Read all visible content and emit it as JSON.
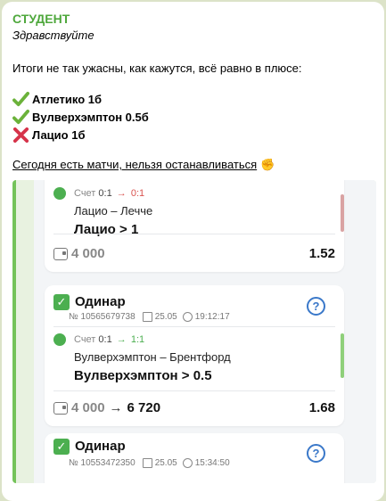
{
  "message": {
    "sender": "СТУДЕНТ",
    "greeting": "Здравствуйте",
    "intro": "Итоги не так ужасны, как кажутся, всё равно в плюсе:",
    "results": [
      {
        "icon": "check-mark-icon",
        "text": "Атлетико 1б"
      },
      {
        "icon": "check-mark-icon",
        "text": "Вулверхэмптон 0.5б"
      },
      {
        "icon": "cross-mark-icon",
        "text": "Лацио 1б"
      }
    ],
    "link_text": "Сегодня есть матчи, нельзя останавливаться",
    "link_emoji": "✊"
  },
  "embed": {
    "card1": {
      "score_label": "Счет",
      "score_from": "0:1",
      "score_to": "0:1",
      "teams": "Лацио – Лечче",
      "pick": "Лацио > 1",
      "stake": "4 000",
      "odds": "1.52",
      "status_color": "#d9a3a3"
    },
    "card2": {
      "title": "Одинар",
      "number": "№ 10565679738",
      "date": "25.05",
      "time": "19:12:17",
      "help": "?",
      "score_label": "Счет",
      "score_from": "0:1",
      "score_to": "1:1",
      "teams": "Вулверхэмптон – Брентфорд",
      "pick": "Вулверхэмптон > 0.5",
      "stake": "4 000",
      "win": "6 720",
      "odds": "1.68",
      "status_color": "#8fd07a"
    },
    "card3": {
      "title": "Одинар",
      "number": "№ 10553472350",
      "date": "25.05",
      "time": "15:34:50",
      "help": "?"
    }
  }
}
